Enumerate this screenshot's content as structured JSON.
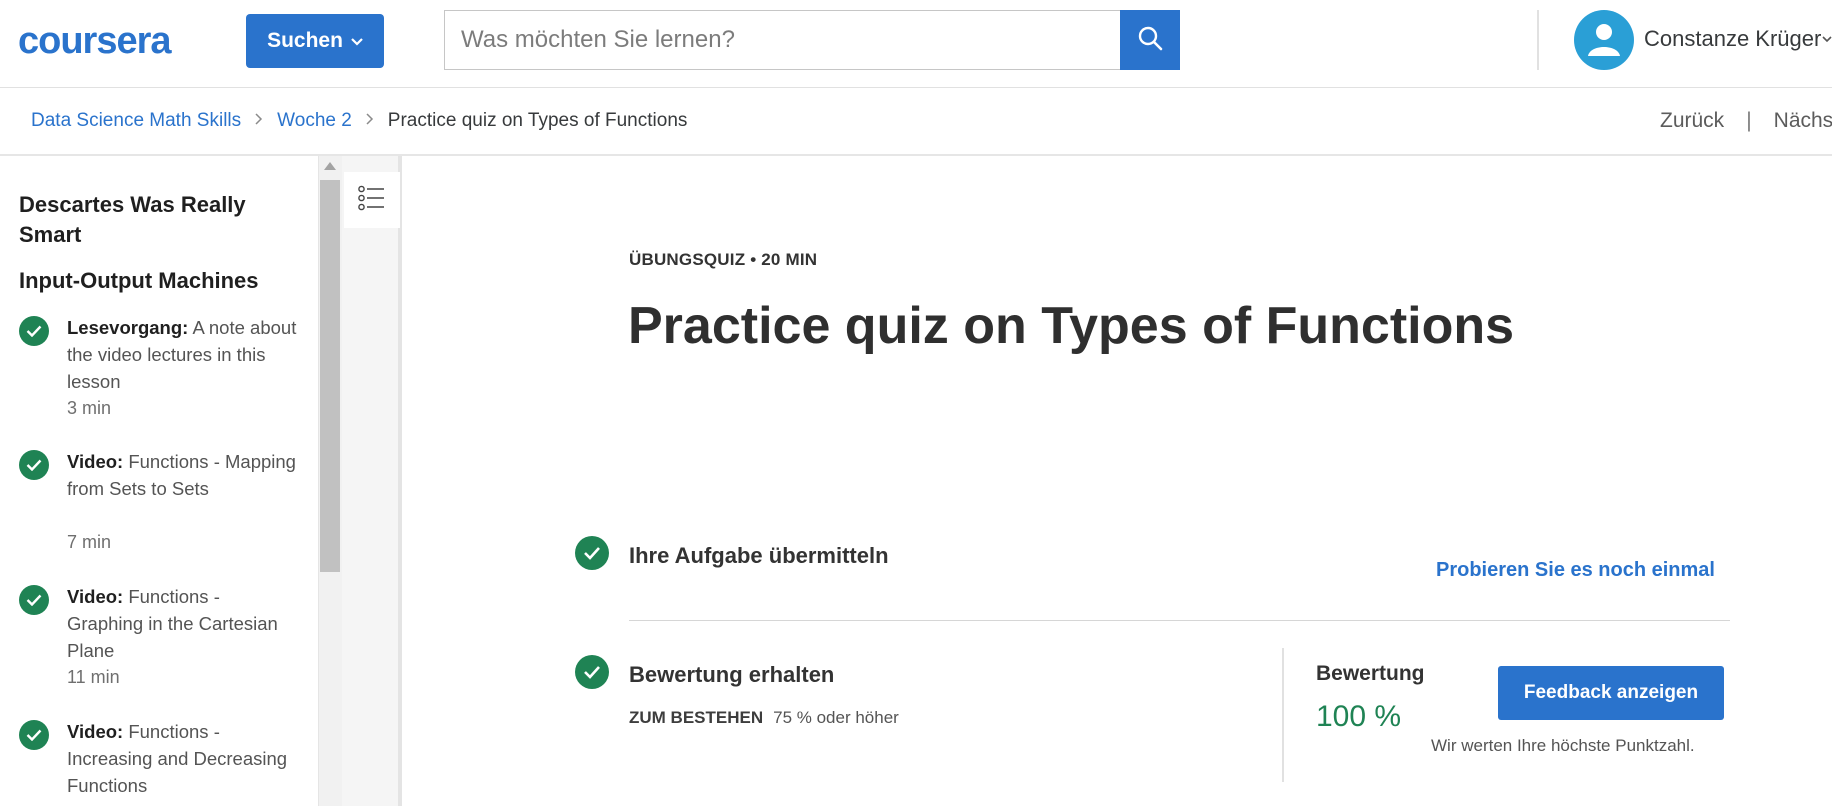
{
  "header": {
    "logo": "coursera",
    "explore_label": "Suchen",
    "search_placeholder": "Was möchten Sie lernen?",
    "user_name": "Constanze Krüger"
  },
  "breadcrumb": {
    "items": [
      "Data Science Math Skills",
      "Woche 2"
    ],
    "current": "Practice quiz on Types of Functions",
    "back_label": "Zurück",
    "next_label": "Nächs"
  },
  "sidebar": {
    "section_titles": [
      "Descartes Was Really Smart",
      "Input-Output Machines"
    ],
    "items": [
      {
        "type": "Lesevorgang:",
        "title": "A note about the video lectures in this lesson",
        "duration": "3 min"
      },
      {
        "type": "Video:",
        "title": "Functions - Mapping from Sets to Sets",
        "duration": "7 min"
      },
      {
        "type": "Video:",
        "title": "Functions - Graphing in the Cartesian Plane",
        "duration": "11 min"
      },
      {
        "type": "Video:",
        "title": "Functions - Increasing and Decreasing Functions",
        "duration": ""
      }
    ]
  },
  "main": {
    "eyebrow": "ÜBUNGSQUIZ • 20 MIN",
    "title": "Practice quiz on Types of Functions",
    "submit_step": {
      "title": "Ihre Aufgabe übermitteln",
      "retry_label": "Probieren Sie es noch einmal"
    },
    "grade_step": {
      "title": "Bewertung erhalten",
      "pass_label": "ZUM BESTEHEN",
      "pass_value": "75 % oder höher",
      "grade_label": "Bewertung",
      "grade_value": "100 %",
      "feedback_label": "Feedback anzeigen",
      "note": "Wir werten Ihre höchste Punktzahl."
    }
  },
  "colors": {
    "accent": "#2a73cc",
    "success": "#1f8354"
  }
}
